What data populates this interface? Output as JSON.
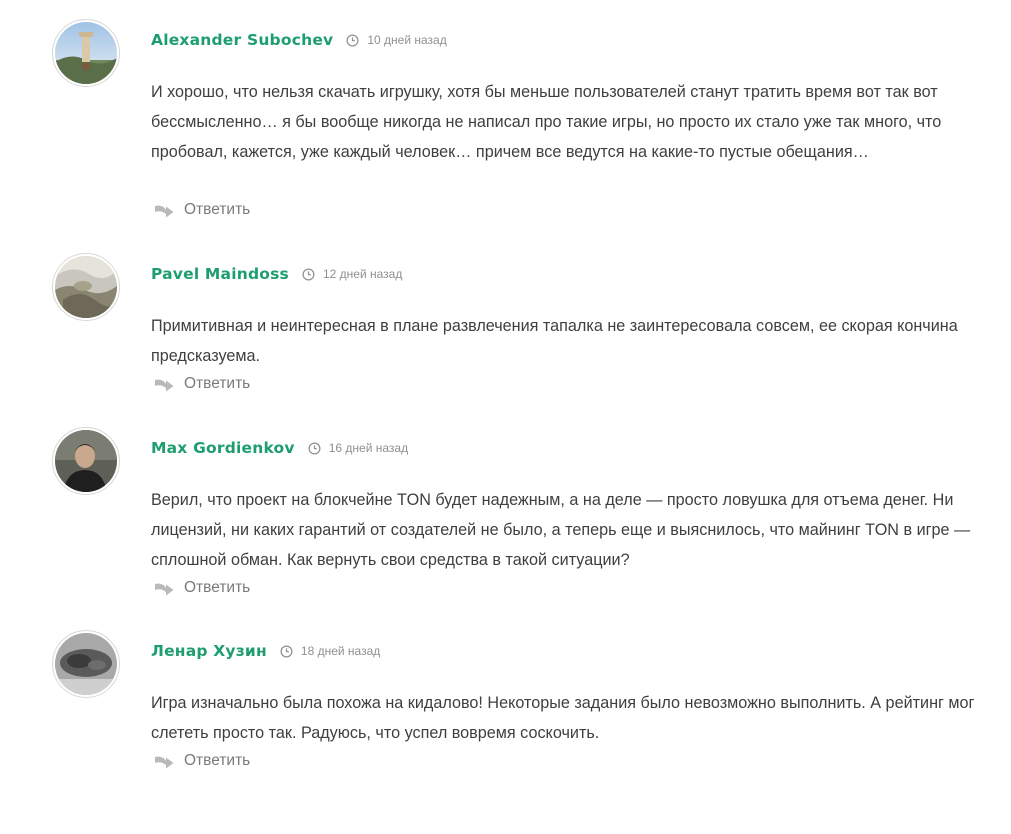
{
  "comments": [
    {
      "author": "Alexander Subochev",
      "time": "10 дней назад",
      "text": "И хорошо, что нельзя скачать игрушку, хотя бы меньше пользователей станут тратить время вот так вот бессмысленно… я бы вообще никогда не написал про такие игры, но просто их стало уже так много, что пробовал, кажется, уже каждый человек… причем все ведутся на какие-то пустые обещания…",
      "reply_label": "Ответить"
    },
    {
      "author": "Pavel Maindoss",
      "time": "12 дней назад",
      "text": "Примитивная и неинтересная в плане развлечения тапалка не заинтересовала совсем, ее скорая кончина предсказуема.",
      "reply_label": "Ответить"
    },
    {
      "author": "Max Gordienkov",
      "time": "16 дней назад",
      "text": "Верил, что проект на блокчейне TON будет надежным, а на деле — просто ловушка для отъема денег. Ни лицензий, ни каких гарантий от создателей не было, а теперь еще и выяснилось, что майнинг TON в игре — сплошной обман. Как вернуть свои средства в такой ситуации?",
      "reply_label": "Ответить"
    },
    {
      "author": "Ленар Хузин",
      "time": "18 дней назад",
      "text": "Игра изначально была похожа на кидалово! Некоторые задания было невозможно выполнить. А рейтинг мог слететь просто так. Радуюсь, что успел вовремя соскочить.",
      "reply_label": "Ответить"
    }
  ],
  "colors": {
    "author": "#1e9e6e",
    "text": "#3f3f3f",
    "meta": "#8f8f8f",
    "reply_icon": "#b9b9b9"
  },
  "icons": {
    "time": "clock-icon",
    "reply": "reply-arrow-icon"
  }
}
